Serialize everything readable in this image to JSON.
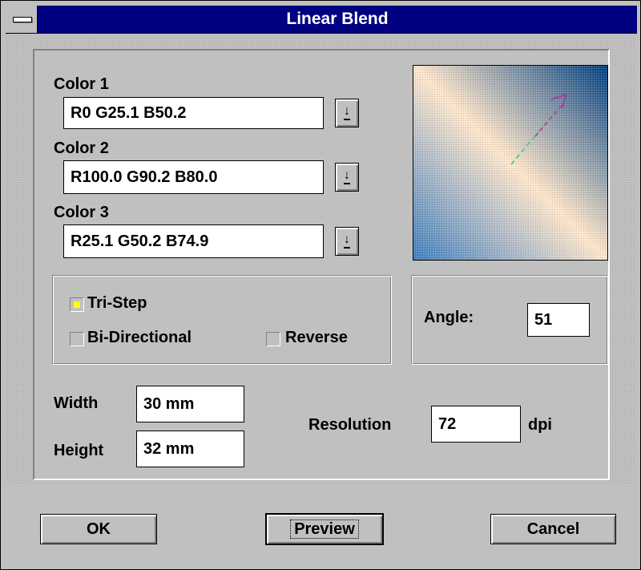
{
  "window": {
    "title": "Linear Blend"
  },
  "colors": [
    {
      "label": "Color 1",
      "value": "R0 G25.1 B50.2"
    },
    {
      "label": "Color 2",
      "value": "R100.0 G90.2 B80.0"
    },
    {
      "label": "Color 3",
      "value": "R25.1 G50.2 B74.9"
    }
  ],
  "options": {
    "tri_step": {
      "label": "Tri-Step",
      "checked": true
    },
    "bi_directional": {
      "label": "Bi-Directional",
      "checked": false
    },
    "reverse": {
      "label": "Reverse",
      "checked": false
    }
  },
  "angle": {
    "label": "Angle:",
    "value": "51"
  },
  "size": {
    "width_label": "Width",
    "width_value": "30 mm",
    "height_label": "Height",
    "height_value": "32 mm"
  },
  "resolution": {
    "label": "Resolution",
    "value": "72",
    "unit": "dpi"
  },
  "buttons": {
    "ok": "OK",
    "preview": "Preview",
    "cancel": "Cancel"
  },
  "dropdown_glyph": "↓",
  "preview_colors": [
    "#00407f",
    "#ffe6cc",
    "#4080bf"
  ],
  "accent": {
    "title_bar": "#000080",
    "checkbox_fill": "#ffff00"
  }
}
